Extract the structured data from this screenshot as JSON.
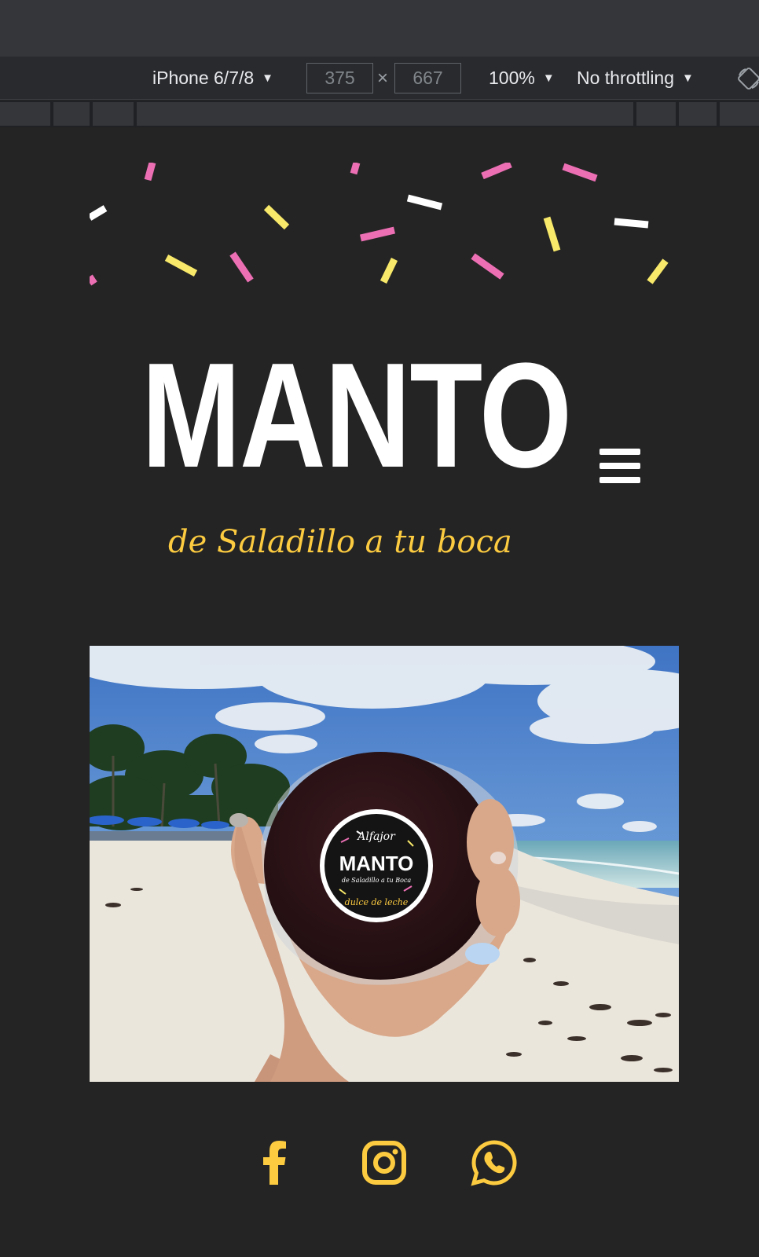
{
  "devtools": {
    "device": "iPhone 6/7/8",
    "width": "375",
    "height": "667",
    "dim_separator": "×",
    "zoom": "100%",
    "throttling": "No throttling",
    "caret": "▼"
  },
  "site": {
    "logo": "MANTO",
    "tagline": "de Saladillo a tu boca",
    "menu_icon": "hamburger-menu-icon",
    "hero_image": {
      "package_top": "Alfajor",
      "package_brand": "MANTO",
      "package_sub": "de Saladillo a tu Boca",
      "package_bottom": "dulce de leche"
    },
    "social": [
      {
        "name": "facebook-icon",
        "color": "#fccb40"
      },
      {
        "name": "instagram-icon",
        "color": "#fccb40"
      },
      {
        "name": "whatsapp-icon",
        "color": "#fccb40"
      }
    ]
  },
  "colors": {
    "background": "#242424",
    "accent_yellow": "#fccb40",
    "confetti_pink": "#ec6fb4",
    "confetti_yellow": "#f8e96a",
    "confetti_white": "#ffffff"
  }
}
